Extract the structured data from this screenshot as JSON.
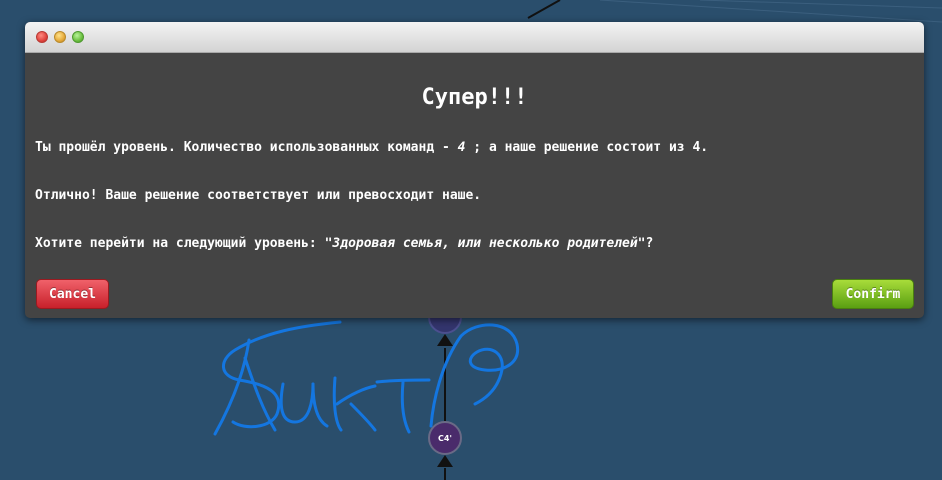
{
  "modal": {
    "title": "Супер!!!",
    "line1_prefix": "Ты прошёл уровень. Количество использованных команд - ",
    "line1_count": "4",
    "line1_suffix": " ; а наше решение состоит из 4.",
    "line2": "Отлично! Ваше решение соответствует или превосходит наше.",
    "line3_prefix": "Хотите перейти на следующий уровень: ",
    "line3_level": "\"Здоровая семья, или несколько родителей\"",
    "line3_suffix": "?",
    "cancel_label": "Cancel",
    "confirm_label": "Confirm"
  },
  "graph": {
    "commit_label": "C4'"
  },
  "colors": {
    "background": "#2a4e6c",
    "modal": "#444444",
    "cancel": "#c8202a",
    "confirm": "#5a9f12",
    "signature": "#1476e0"
  }
}
